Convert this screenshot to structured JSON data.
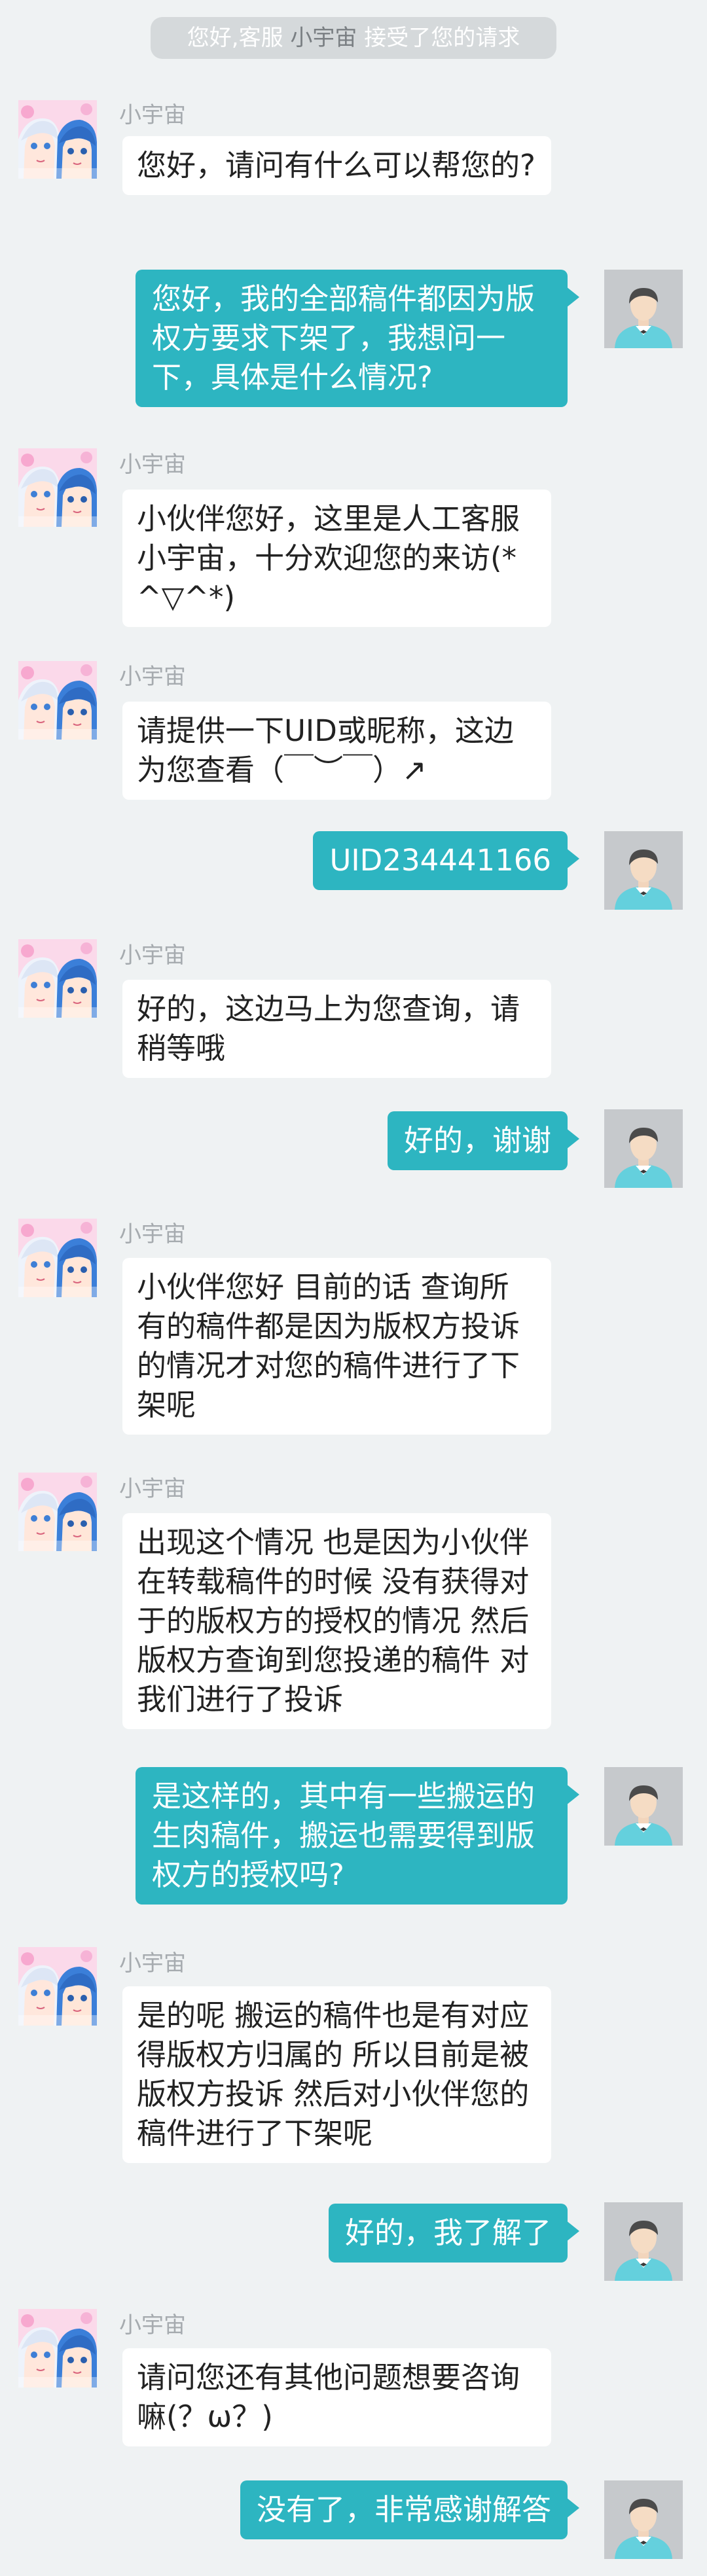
{
  "system_notice": {
    "prefix": "您好,客服",
    "agent": "小宇宙",
    "suffix": "接受了您的请求"
  },
  "colors": {
    "background": "#eff2f3",
    "outgoing_bubble": "#2db5c1",
    "incoming_bubble": "#ffffff",
    "sender_name": "#a6abaf",
    "notice_bg": "#d5d9db"
  },
  "messages": [
    {
      "from": "agent",
      "sender": "小宇宙",
      "text": "您好，请问有什么可以帮您的?"
    },
    {
      "from": "user",
      "text": "您好，我的全部稿件都因为版权方要求下架了，我想问一下，具体是什么情况?"
    },
    {
      "from": "agent",
      "sender": "小宇宙",
      "text": "小伙伴您好，这里是人工客服小宇宙，十分欢迎您的来访(*^▽^*)"
    },
    {
      "from": "agent",
      "sender": "小宇宙",
      "text": "请提供一下UID或昵称，这边为您查看（￣︶￣）↗"
    },
    {
      "from": "user",
      "text": "UID234441166"
    },
    {
      "from": "agent",
      "sender": "小宇宙",
      "text": "好的，这边马上为您查询，请稍等哦"
    },
    {
      "from": "user",
      "text": "好的，谢谢"
    },
    {
      "from": "agent",
      "sender": "小宇宙",
      "text": "小伙伴您好 目前的话 查询所有的稿件都是因为版权方投诉的情况才对您的稿件进行了下架呢"
    },
    {
      "from": "agent",
      "sender": "小宇宙",
      "text": "出现这个情况 也是因为小伙伴在转载稿件的时候 没有获得对于的版权方的授权的情况 然后版权方查询到您投递的稿件 对我们进行了投诉"
    },
    {
      "from": "user",
      "text": "是这样的，其中有一些搬运的生肉稿件，搬运也需要得到版权方的授权吗?"
    },
    {
      "from": "agent",
      "sender": "小宇宙",
      "text": "是的呢 搬运的稿件也是有对应得版权方归属的 所以目前是被版权方投诉 然后对小伙伴您的稿件进行了下架呢"
    },
    {
      "from": "user",
      "text": "好的，我了解了"
    },
    {
      "from": "agent",
      "sender": "小宇宙",
      "text": "请问您还有其他问题想要咨询嘛(？ω？)"
    },
    {
      "from": "user",
      "text": "没有了，非常感谢解答"
    }
  ]
}
